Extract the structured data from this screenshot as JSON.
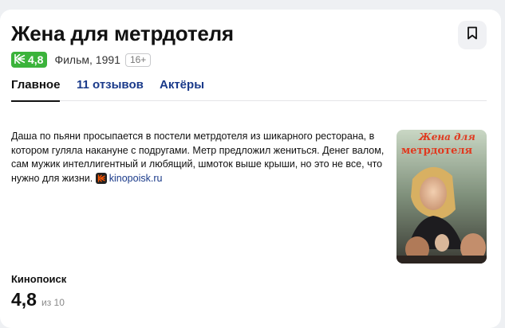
{
  "movie": {
    "title": "Жена для метрдотеля",
    "rating": "4,8",
    "type_year": "Фильм, 1991",
    "age": "16+"
  },
  "tabs": [
    {
      "label": "Главное",
      "active": true
    },
    {
      "label": "11 отзывов",
      "active": false
    },
    {
      "label": "Актёры",
      "active": false
    }
  ],
  "description": {
    "text": "Даша по пьяни просыпается в постели метрдотеля из шикарного ресторана, в котором гуляла накануне с подругами. Метр предложил жениться. Денег валом, сам мужик интеллигентный и любящий, шмоток выше крыши, но это не все, что нужно для жизни.",
    "source": "kinopoisk.ru"
  },
  "poster": {
    "title_line1": "Жена для",
    "title_line2": "метрдотеля"
  },
  "ratings_section": {
    "label": "Кинопоиск",
    "value": "4,8",
    "scale": "из 10"
  },
  "icons": {
    "bookmark": "bookmark-icon",
    "rating_badge": "kinopoisk-rating-icon",
    "source": "kinopoisk-logo-icon"
  },
  "colors": {
    "rating_badge": "#3bb33b",
    "link": "#1a3a8a",
    "source_logo": "#ff5500"
  }
}
